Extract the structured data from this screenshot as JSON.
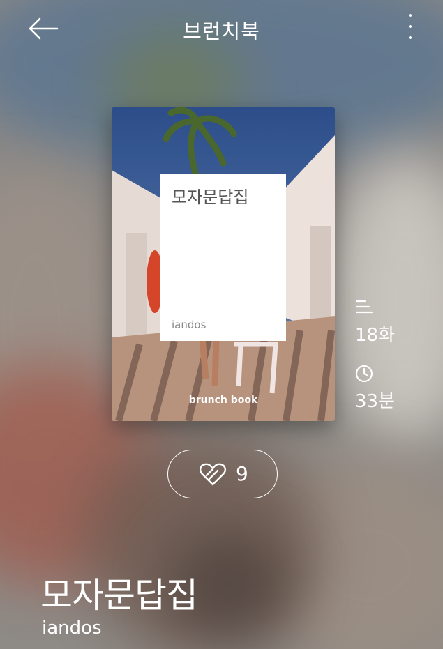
{
  "header": {
    "title": "브런치북",
    "back_icon": "arrow-left-icon",
    "more_icon": "more-vertical-icon"
  },
  "cover": {
    "title": "모자문답집",
    "author": "iandos",
    "brand": "brunch book"
  },
  "meta": {
    "episodes": {
      "icon": "list-icon",
      "value": "18화"
    },
    "duration": {
      "icon": "clock-icon",
      "value": "33분"
    }
  },
  "like": {
    "icon": "like-heart-icon",
    "count": "9"
  },
  "book": {
    "title": "모자문답집",
    "author": "iandos"
  }
}
